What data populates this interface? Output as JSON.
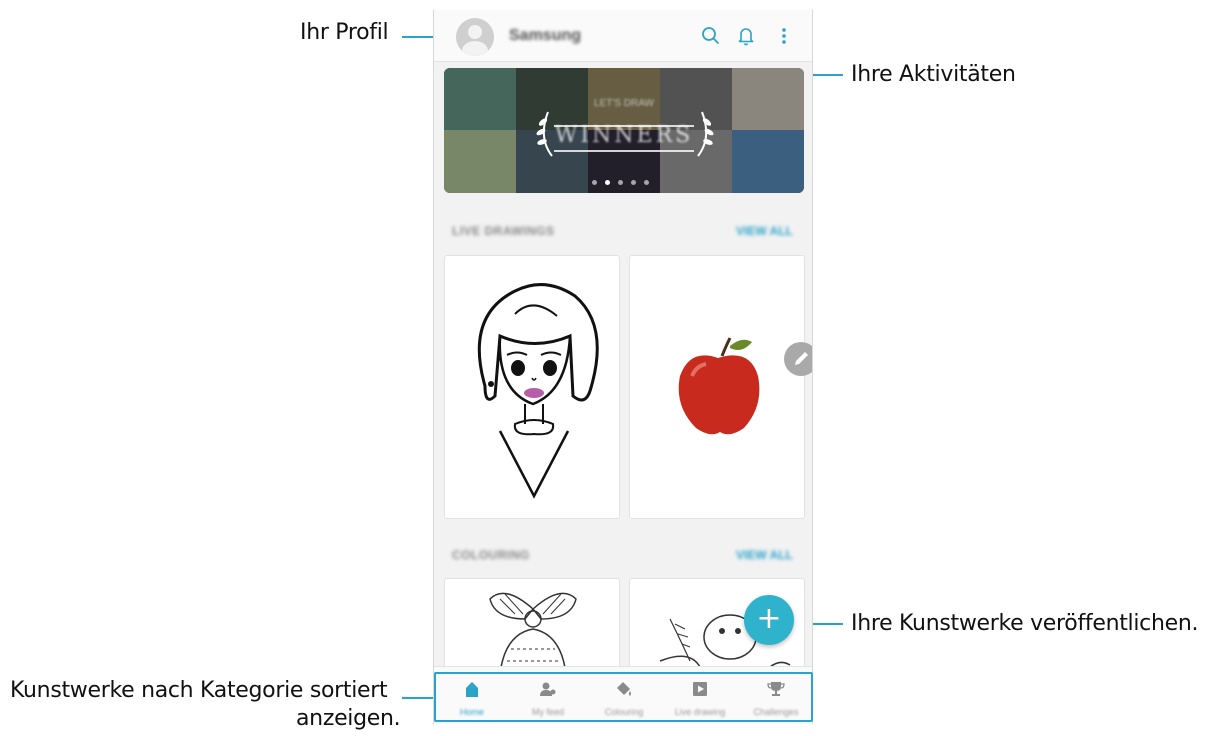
{
  "callouts": {
    "profile": "Ihr Profil",
    "activities": "Ihre Aktivitäten",
    "publish": "Ihre Kunstwerke veröffentlichen.",
    "category_line1": "Kunstwerke nach Kategorie sortiert",
    "category_line2": "anzeigen."
  },
  "app": {
    "username": "Samsung",
    "banner_text": "WINNERS",
    "banner_subtext": "LET'S DRAW"
  },
  "sections": {
    "live_drawings": {
      "title": "LIVE DRAWINGS",
      "view_all": "VIEW ALL"
    },
    "colouring": {
      "title": "COLOURING",
      "view_all": "VIEW ALL"
    }
  },
  "fab": {
    "label": "+"
  },
  "bottom_nav": [
    {
      "label": "Home",
      "icon": "home-icon",
      "active": true
    },
    {
      "label": "My feed",
      "icon": "people-icon",
      "active": false
    },
    {
      "label": "Colouring",
      "icon": "paint-bucket-icon",
      "active": false
    },
    {
      "label": "Live drawing",
      "icon": "play-icon",
      "active": false
    },
    {
      "label": "Challenges",
      "icon": "trophy-icon",
      "active": false
    }
  ],
  "colors": {
    "accent": "#2aa3c9",
    "fab": "#2fb3cc"
  }
}
